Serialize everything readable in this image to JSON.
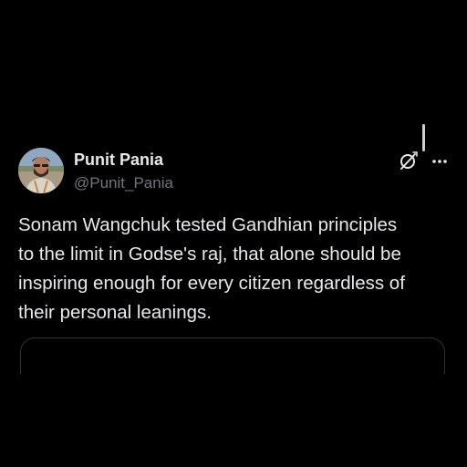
{
  "post": {
    "author": {
      "display_name": "Punit Pania",
      "handle": "@Punit_Pania"
    },
    "text_lines": [
      "Sonam Wangchuk tested Gandhian principles",
      "to the limit in Godse's raj, that alone should be",
      "inspiring enough for every citizen regardless of",
      "their personal leanings."
    ],
    "actions": {
      "grok_icon": "grok-icon",
      "more_icon": "more-options-icon"
    }
  },
  "colors": {
    "background": "#000000",
    "primary_text": "#e7e9ea",
    "secondary_text": "#71767b",
    "divider": "#2f3336"
  }
}
